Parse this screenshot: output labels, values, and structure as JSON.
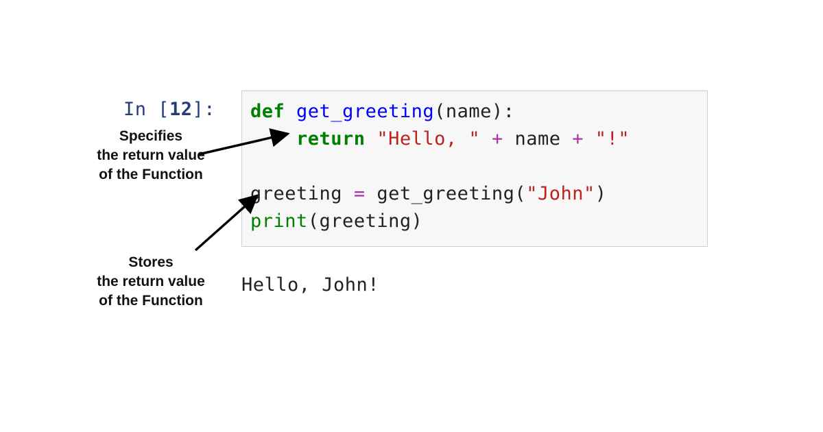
{
  "prompt": {
    "label_prefix": "In [",
    "number": "12",
    "label_suffix": "]:"
  },
  "code": {
    "line1": {
      "def": "def",
      "sp1": " ",
      "fn": "get_greeting",
      "lp": "(",
      "arg": "name",
      "rp": ")",
      "colon": ":"
    },
    "line2": {
      "indent": "    ",
      "ret": "return",
      "sp": " ",
      "q1a": "\"",
      "s1": "Hello, ",
      "q1b": "\"",
      "sp2": " ",
      "plus1": "+",
      "sp3": " ",
      "name": "name",
      "sp4": " ",
      "plus2": "+",
      "sp5": " ",
      "q2a": "\"",
      "s2": "!",
      "q2b": "\""
    },
    "line4": {
      "lhs": "greeting",
      "sp1": " ",
      "eq": "=",
      "sp2": " ",
      "call": "get_greeting",
      "lp": "(",
      "qa": "\"",
      "arg": "John",
      "qb": "\"",
      "rp": ")"
    },
    "line5": {
      "print": "print",
      "lp": "(",
      "arg": "greeting",
      "rp": ")"
    }
  },
  "output_text": "Hello, John!",
  "annotations": {
    "a1_l1": "Specifies",
    "a1_l2": "the return value",
    "a1_l3": "of the Function",
    "a2_l1": "Stores",
    "a2_l2": "the return value",
    "a2_l3": "of the Function"
  }
}
